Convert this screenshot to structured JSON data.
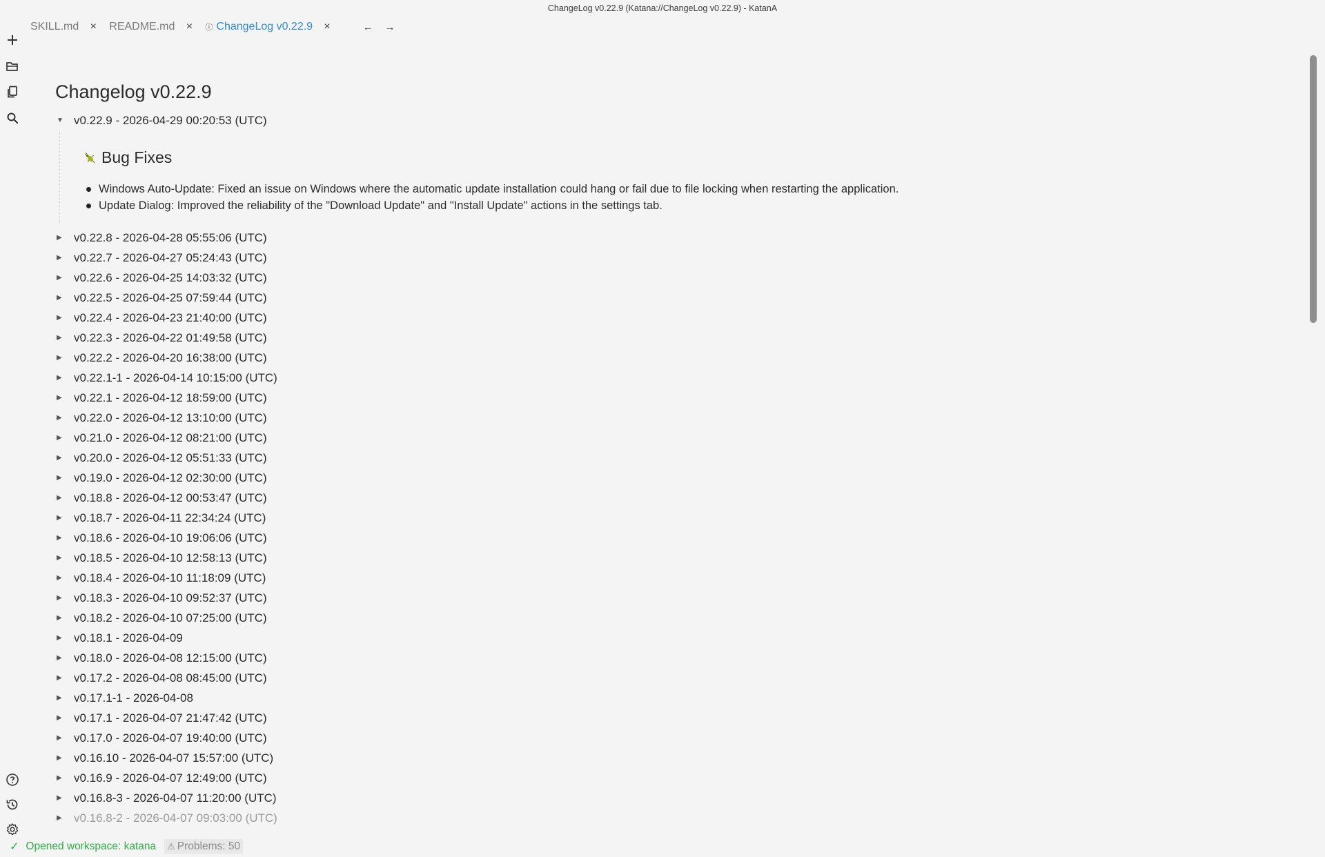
{
  "window": {
    "title": "ChangeLog v0.22.9 (Katana://ChangeLog v0.22.9) - KatanA"
  },
  "colors": {
    "accent": "#2f8ed0",
    "success": "#2fae47",
    "background": "#f4f4f4"
  },
  "activity_bar": {
    "top": [
      "new-file-icon",
      "open-folder-icon",
      "files-icon",
      "search-icon"
    ],
    "bottom": [
      "help-icon",
      "history-icon",
      "settings-icon"
    ]
  },
  "tabs": [
    {
      "label": "SKILL.md",
      "close": "×"
    },
    {
      "label": "README.md",
      "close": "×"
    },
    {
      "label": "ChangeLog v0.22.9",
      "close": "×",
      "info": "ⓘ"
    }
  ],
  "tab_nav": {
    "back": "←",
    "forward": "→"
  },
  "document": {
    "title": "Changelog v0.22.9",
    "expanded": {
      "caret": "▼",
      "label": "v0.22.9 - 2026-04-29 00:20:53 (UTC)",
      "section_title": "Bug Fixes",
      "section_icon": "bug-icon",
      "bullets": [
        "Windows Auto-Update: Fixed an issue on Windows where the automatic update installation could hang or fail due to file locking when restarting the application.",
        "Update Dialog: Improved the reliability of the \"Download Update\" and \"Install Update\" actions in the settings tab."
      ]
    },
    "collapsed_caret": "▶",
    "entries": [
      "v0.22.8 - 2026-04-28 05:55:06 (UTC)",
      "v0.22.7 - 2026-04-27 05:24:43 (UTC)",
      "v0.22.6 - 2026-04-25 14:03:32 (UTC)",
      "v0.22.5 - 2026-04-25 07:59:44 (UTC)",
      "v0.22.4 - 2026-04-23 21:40:00 (UTC)",
      "v0.22.3 - 2026-04-22 01:49:58 (UTC)",
      "v0.22.2 - 2026-04-20 16:38:00 (UTC)",
      "v0.22.1-1 - 2026-04-14 10:15:00 (UTC)",
      "v0.22.1 - 2026-04-12 18:59:00 (UTC)",
      "v0.22.0 - 2026-04-12 13:10:00 (UTC)",
      "v0.21.0 - 2026-04-12 08:21:00 (UTC)",
      "v0.20.0 - 2026-04-12 05:51:33 (UTC)",
      "v0.19.0 - 2026-04-12 02:30:00 (UTC)",
      "v0.18.8 - 2026-04-12 00:53:47 (UTC)",
      "v0.18.7 - 2026-04-11 22:34:24 (UTC)",
      "v0.18.6 - 2026-04-10 19:06:06 (UTC)",
      "v0.18.5 - 2026-04-10 12:58:13 (UTC)",
      "v0.18.4 - 2026-04-10 11:18:09 (UTC)",
      "v0.18.3 - 2026-04-10 09:52:37 (UTC)",
      "v0.18.2 - 2026-04-10 07:25:00 (UTC)",
      "v0.18.1 - 2026-04-09",
      "v0.18.0 - 2026-04-08 12:15:00 (UTC)",
      "v0.17.2 - 2026-04-08 08:45:00 (UTC)",
      "v0.17.1-1 - 2026-04-08",
      "v0.17.1 - 2026-04-07 21:47:42 (UTC)",
      "v0.17.0 - 2026-04-07 19:40:00 (UTC)",
      "v0.16.10 - 2026-04-07 15:57:00 (UTC)",
      "v0.16.9 - 2026-04-07 12:49:00 (UTC)",
      "v0.16.8-3 - 2026-04-07 11:20:00 (UTC)",
      "v0.16.8-2 - 2026-04-07 09:03:00 (UTC)"
    ]
  },
  "status_bar": {
    "check": "✓",
    "message": "Opened workspace: katana",
    "warning_icon": "⚠",
    "problems": "Problems: 50"
  }
}
